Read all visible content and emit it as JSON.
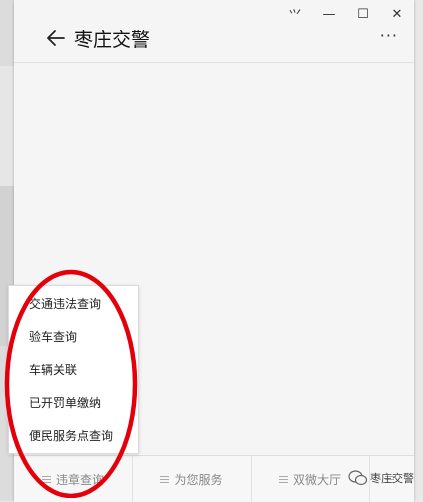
{
  "window": {
    "title": "枣庄交警",
    "back_icon": "arrow-left-icon",
    "more_label": "···",
    "controls": {
      "pin": "⺍",
      "minimize": "—",
      "maximize": "☐",
      "close": "✕"
    }
  },
  "menu": {
    "tabs": [
      {
        "label": "违章查询",
        "icon": "menu-lines-icon"
      },
      {
        "label": "为您服务",
        "icon": "menu-lines-icon"
      },
      {
        "label": "双微大厅",
        "icon": "menu-lines-icon"
      },
      {
        "label": "",
        "icon": "menu-lines-icon"
      }
    ],
    "submenu": [
      "交通违法查询",
      "验车查询",
      "车辆关联",
      "已开罚单缴纳",
      "便民服务点查询"
    ]
  },
  "annotation": {
    "color": "#e3000b",
    "shape": "ellipse"
  },
  "watermark": {
    "text": "枣庄交警",
    "icon": "wechat-icon"
  }
}
